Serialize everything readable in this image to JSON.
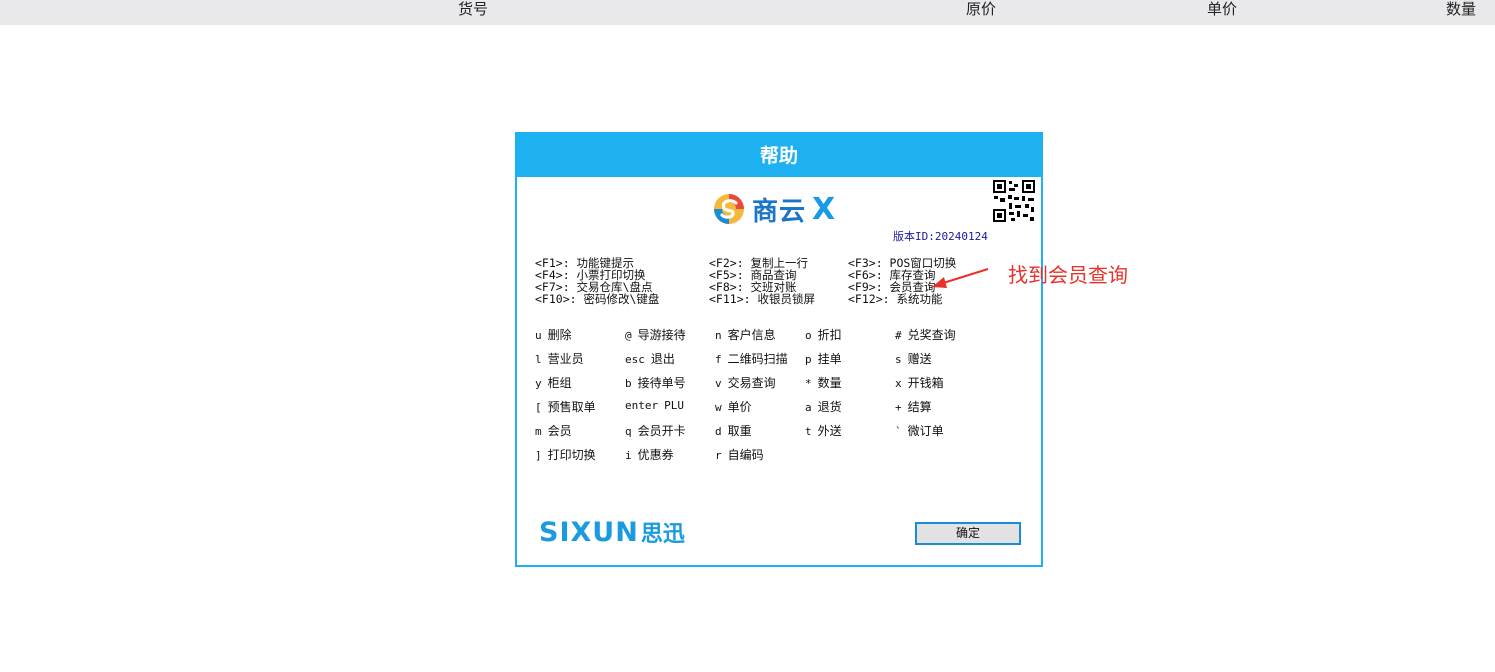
{
  "header": {
    "columns": [
      "货号",
      "原价",
      "单价",
      "数量"
    ]
  },
  "dialog": {
    "title": "帮助",
    "logo_text": "商云",
    "logo_x": "X",
    "version": "版本ID:20240124",
    "function_keys": [
      [
        "<F1>: 功能键提示",
        "<F2>: 复制上一行",
        "<F3>: POS窗口切换"
      ],
      [
        "<F4>: 小票打印切换",
        "<F5>: 商品查询",
        "<F6>: 库存查询"
      ],
      [
        "<F7>: 交易仓库\\盘点",
        "<F8>: 交班对账",
        "<F9>: 会员查询"
      ],
      [
        "<F10>: 密码修改\\键盘",
        "<F11>: 收银员锁屏",
        "<F12>: 系统功能"
      ]
    ],
    "shortcuts": [
      [
        [
          "u",
          "删除"
        ],
        [
          "@",
          "导游接待"
        ],
        [
          "n",
          "客户信息"
        ],
        [
          "o",
          "折扣"
        ],
        [
          "#",
          "兑奖查询"
        ]
      ],
      [
        [
          "l",
          "营业员"
        ],
        [
          "esc",
          "退出"
        ],
        [
          "f",
          "二维码扫描"
        ],
        [
          "p",
          "挂单"
        ],
        [
          "s",
          "赠送"
        ]
      ],
      [
        [
          "y",
          "柜组"
        ],
        [
          "b",
          "接待单号"
        ],
        [
          "v",
          "交易查询"
        ],
        [
          "*",
          "数量"
        ],
        [
          "x",
          "开钱箱"
        ]
      ],
      [
        [
          "[",
          "预售取单"
        ],
        [
          "enter",
          "PLU"
        ],
        [
          "w",
          "单价"
        ],
        [
          "a",
          "退货"
        ],
        [
          "+",
          "结算"
        ]
      ],
      [
        [
          "m",
          "会员"
        ],
        [
          "q",
          "会员开卡"
        ],
        [
          "d",
          "取重"
        ],
        [
          "t",
          "外送"
        ],
        [
          "`",
          "微订单"
        ]
      ],
      [
        [
          "]",
          "打印切换"
        ],
        [
          "i",
          "优惠券"
        ],
        [
          "r",
          "自编码"
        ]
      ]
    ],
    "brand_en": "SIXUN",
    "brand_zh": "思迅",
    "ok_label": "确定"
  },
  "annotation": {
    "text": "找到会员查询",
    "color": "#e8312a"
  },
  "colors": {
    "accent": "#1db1f2",
    "header_bg": "#e9e9ec"
  }
}
